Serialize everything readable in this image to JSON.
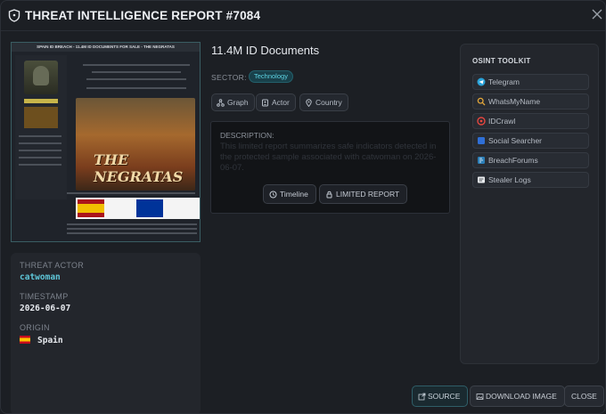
{
  "header": {
    "title": "THREAT INTELLIGENCE REPORT #7084"
  },
  "screenshot": {
    "heading": "SPAIN ID BREACH - 11.4M ID DOCUMENTS FOR SALE - THE NEGRATAS",
    "username": "catwoman",
    "banner_text": "THE NEGRATAS"
  },
  "details": {
    "actor_label": "THREAT ACTOR",
    "actor_value": "catwoman",
    "timestamp_label": "TIMESTAMP",
    "timestamp_value": "2026-06-07",
    "origin_label": "ORIGIN",
    "origin_value": "Spain"
  },
  "report": {
    "title": "11.4M ID Documents",
    "sector_label": "SECTOR:",
    "sector_value": "Technology",
    "pills": {
      "graph": "Graph",
      "actor": "Actor",
      "country": "Country"
    },
    "description_label": "DESCRIPTION:",
    "description_text": "This limited report summarizes safe indicators detected in the protected sample associated with catwoman on 2026-06-07.",
    "timeline_label": "Timeline",
    "limited_label": "LIMITED REPORT"
  },
  "toolkit": {
    "title": "OSINT TOOLKIT",
    "items": [
      "Telegram",
      "WhatsMyName",
      "IDCrawl",
      "Social Searcher",
      "BreachForums",
      "Stealer Logs"
    ]
  },
  "footer": {
    "source": "SOURCE",
    "download": "DOWNLOAD IMAGE",
    "close": "CLOSE"
  },
  "colors": {
    "accent": "#5ec6d8",
    "background": "#1c1f24",
    "panel": "#23262c"
  }
}
